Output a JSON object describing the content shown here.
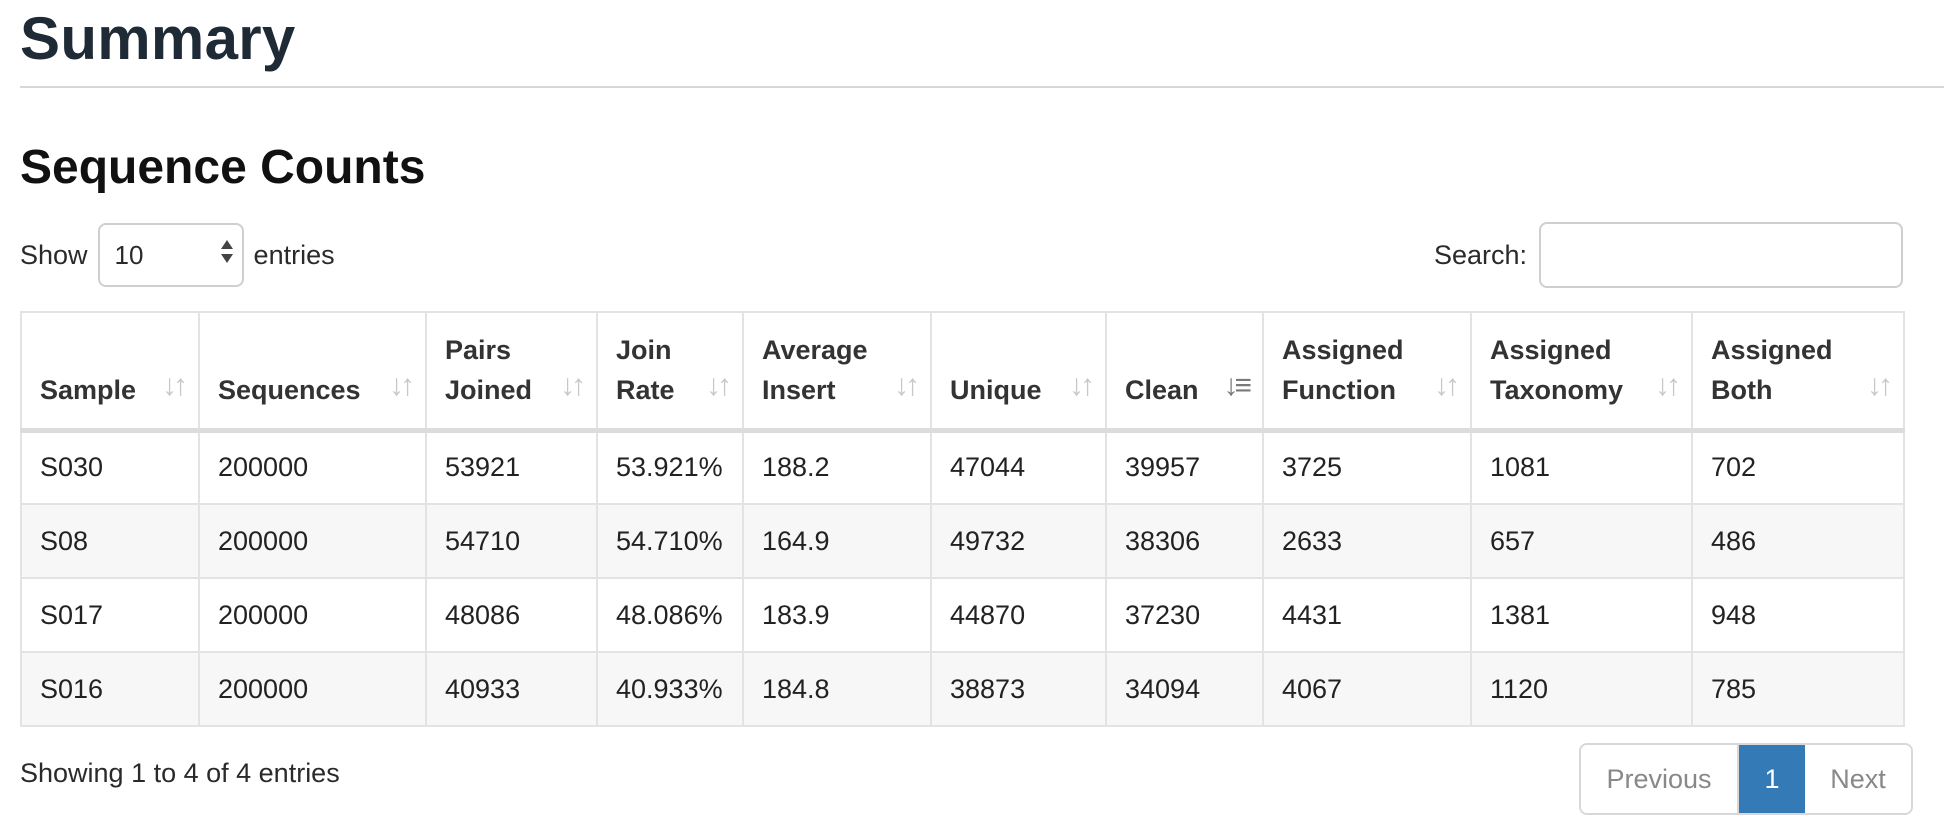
{
  "page": {
    "title": "Summary"
  },
  "section": {
    "title": "Sequence Counts"
  },
  "length_control": {
    "show_label": "Show",
    "selected": "10",
    "entries_label": "entries"
  },
  "search": {
    "label": "Search:",
    "value": "",
    "placeholder": ""
  },
  "table": {
    "headers": [
      {
        "label": "Sample",
        "sort": "both"
      },
      {
        "label": "Sequences",
        "sort": "both"
      },
      {
        "label": "Pairs Joined",
        "sort": "both"
      },
      {
        "label": "Join Rate",
        "sort": "both"
      },
      {
        "label": "Average Insert",
        "sort": "both"
      },
      {
        "label": "Unique",
        "sort": "both"
      },
      {
        "label": "Clean",
        "sort": "desc"
      },
      {
        "label": "Assigned Function",
        "sort": "both"
      },
      {
        "label": "Assigned Taxonomy",
        "sort": "both"
      },
      {
        "label": "Assigned Both",
        "sort": "both"
      }
    ],
    "rows": [
      [
        "S030",
        "200000",
        "53921",
        "53.921%",
        "188.2",
        "47044",
        "39957",
        "3725",
        "1081",
        "702"
      ],
      [
        "S08",
        "200000",
        "54710",
        "54.710%",
        "164.9",
        "49732",
        "38306",
        "2633",
        "657",
        "486"
      ],
      [
        "S017",
        "200000",
        "48086",
        "48.086%",
        "183.9",
        "44870",
        "37230",
        "4431",
        "1381",
        "948"
      ],
      [
        "S016",
        "200000",
        "40933",
        "40.933%",
        "184.8",
        "38873",
        "34094",
        "4067",
        "1120",
        "785"
      ]
    ]
  },
  "footer": {
    "info": "Showing 1 to 4 of 4 entries",
    "pagination": {
      "previous": "Previous",
      "current": "1",
      "next": "Next"
    }
  },
  "colors": {
    "accent": "#337ab7",
    "stripe": "#f7f7f7",
    "border": "#e3e3e3"
  },
  "icons": {
    "sort": "sort-arrows-icon",
    "sort_active": "sort-desc-icon",
    "select": "select-arrows-icon"
  }
}
